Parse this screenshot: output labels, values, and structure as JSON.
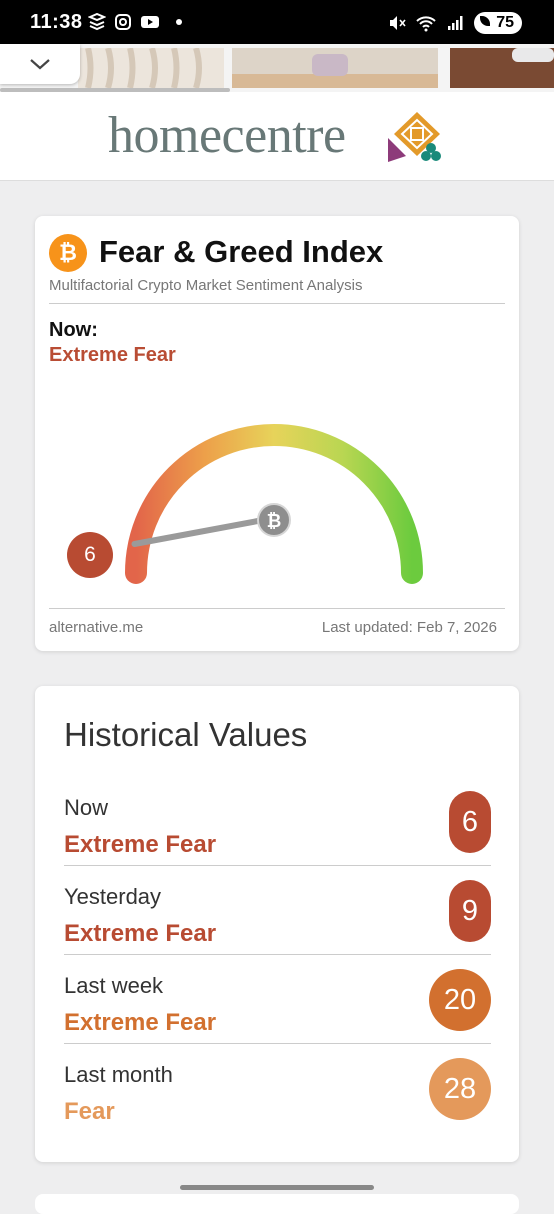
{
  "status_bar": {
    "time": "11:38",
    "battery": "75"
  },
  "banner": {
    "brand": "homecentre"
  },
  "fear_greed": {
    "title": "Fear & Greed Index",
    "subtitle": "Multifactorial Crypto Market Sentiment Analysis",
    "now_label": "Now:",
    "now_value": "Extreme Fear",
    "gauge_value": "6",
    "gauge_level": 6,
    "source": "alternative.me",
    "last_updated": "Last updated: Feb 7, 2026",
    "icon": "bitcoin-icon",
    "accent": "#f7931a"
  },
  "historical": {
    "title": "Historical Values",
    "rows": [
      {
        "period": "Now",
        "label": "Extreme Fear",
        "value": "6",
        "color": "#b84b32"
      },
      {
        "period": "Yesterday",
        "label": "Extreme Fear",
        "value": "9",
        "color": "#b84b32"
      },
      {
        "period": "Last week",
        "label": "Extreme Fear",
        "value": "20",
        "color": "#d2702f"
      },
      {
        "period": "Last month",
        "label": "Fear",
        "value": "28",
        "color": "#e4995b"
      }
    ]
  }
}
